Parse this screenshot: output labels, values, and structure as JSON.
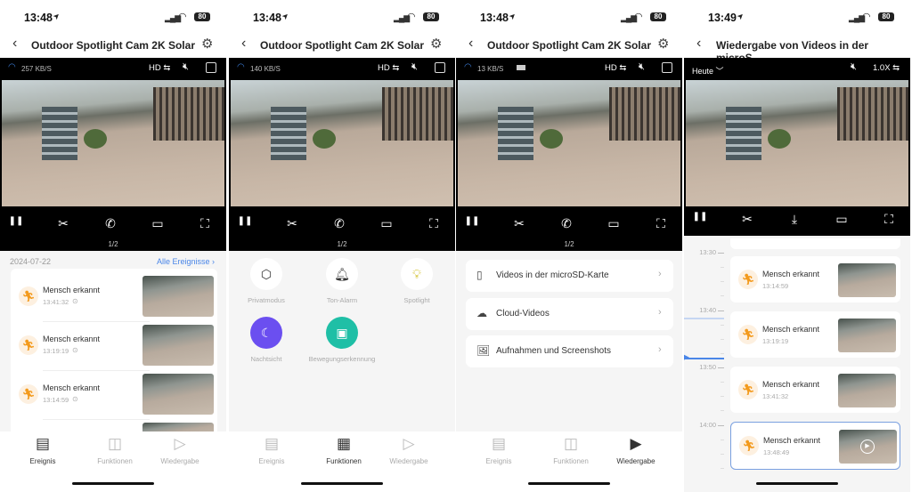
{
  "colors": {
    "accent": "#4a86e8",
    "event_orange": "#f39a1c",
    "night_purple": "#6b4ff0",
    "motion_teal": "#1fbfa6"
  },
  "phones": [
    {
      "time": "13:48",
      "battery": "80",
      "title": "Outdoor Spotlight Cam 2K Solar",
      "speed": "257 KB/S",
      "quality": "HD ⇆",
      "pager": "1/2",
      "events": {
        "date": "2024-07-22",
        "all_link": "Alle Ereignisse  ›",
        "items": [
          {
            "label": "Mensch erkannt",
            "time": "13:41:32"
          },
          {
            "label": "Mensch erkannt",
            "time": "13:19:19"
          },
          {
            "label": "Mensch erkannt",
            "time": "13:14:59"
          }
        ]
      },
      "active_tab": 0
    },
    {
      "time": "13:48",
      "battery": "80",
      "title": "Outdoor Spotlight Cam 2K Solar",
      "speed": "140 KB/S",
      "quality": "HD ⇆",
      "pager": "1/2",
      "functions": [
        {
          "label": "Privatmodus",
          "icon": "shield-icon",
          "active": false
        },
        {
          "label": "Ton-Alarm",
          "icon": "bell-icon",
          "active": false
        },
        {
          "label": "Spotlight",
          "icon": "lightbulb-icon",
          "active": false
        },
        {
          "label": "Nachtsicht",
          "icon": "moon-icon",
          "active": true
        },
        {
          "label": "Bewegungserkennung",
          "icon": "motion-detection-icon",
          "active": true
        }
      ],
      "active_tab": 1
    },
    {
      "time": "13:48",
      "battery": "80",
      "title": "Outdoor Spotlight Cam 2K Solar",
      "speed": "13 KB/S",
      "quality": "HD ⇆",
      "pager": "1/2",
      "menu": [
        {
          "label": "Videos in der microSD-Karte",
          "icon": "sd-card-icon"
        },
        {
          "label": "Cloud-Videos",
          "icon": "cloud-icon"
        },
        {
          "label": "Aufnahmen und Screenshots",
          "icon": "image-icon"
        }
      ],
      "active_tab": 2
    },
    {
      "time": "13:49",
      "battery": "80",
      "title": "Wiedergabe von Videos in der microS...",
      "date_filter": "Heute ﹀",
      "speed": "1.0X ⇆",
      "timeline": {
        "labels": [
          "13:30",
          "13:40",
          "13:50",
          "14:00"
        ],
        "items": [
          {
            "label": "Mensch erkannt",
            "time": "13:14:59"
          },
          {
            "label": "Mensch erkannt",
            "time": "13:19:19"
          },
          {
            "label": "Mensch erkannt",
            "time": "13:41:32"
          },
          {
            "label": "Mensch erkannt",
            "time": "13:48:49",
            "selected": true
          }
        ]
      }
    }
  ],
  "nav": [
    {
      "label": "Ereignis",
      "icon": "event-list-icon"
    },
    {
      "label": "Funktionen",
      "icon": "functions-grid-icon"
    },
    {
      "label": "Wiedergabe",
      "icon": "playback-icon"
    }
  ]
}
